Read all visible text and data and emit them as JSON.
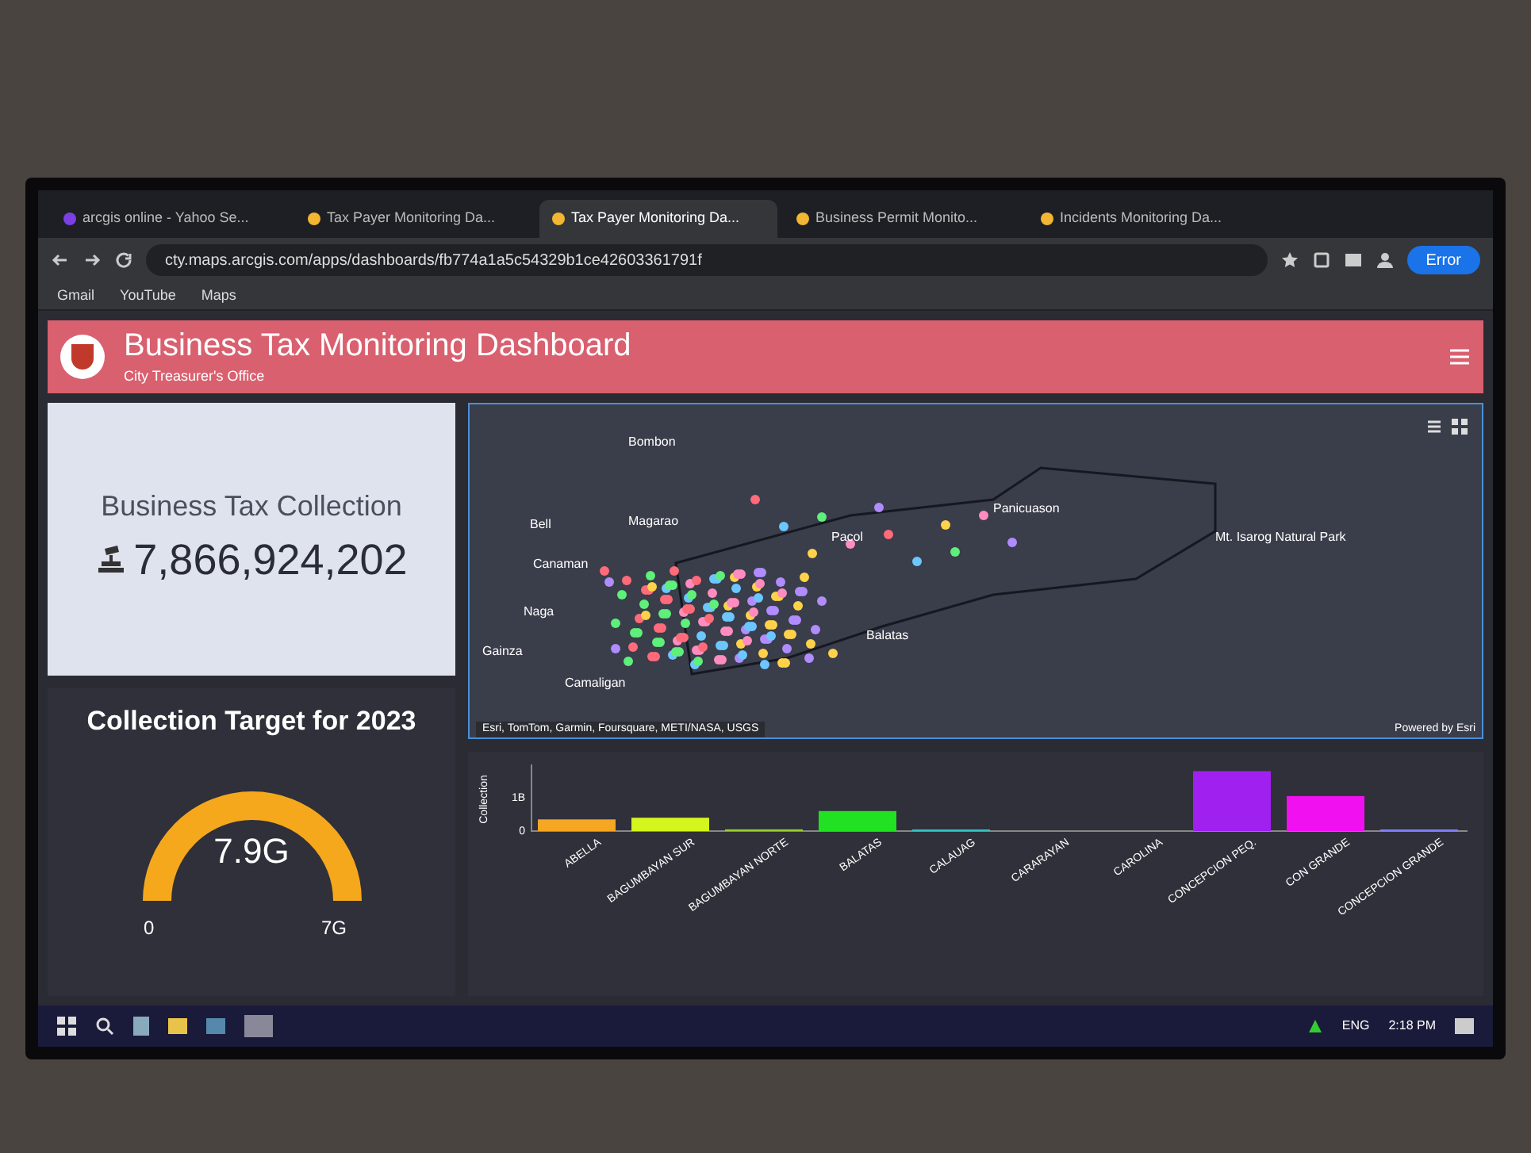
{
  "browser": {
    "tabs": [
      {
        "label": "arcgis online - Yahoo Se...",
        "selected": false
      },
      {
        "label": "Tax Payer Monitoring Da...",
        "selected": false
      },
      {
        "label": "Tax Payer Monitoring Da...",
        "selected": true
      },
      {
        "label": "Business Permit Monito...",
        "selected": false
      },
      {
        "label": "Incidents Monitoring Da...",
        "selected": false
      }
    ],
    "url": "cty.maps.arcgis.com/apps/dashboards/fb774a1a5c54329b1ce42603361791f",
    "bookmarks": [
      "Gmail",
      "YouTube",
      "Maps"
    ],
    "profile_button": "Error"
  },
  "header": {
    "title": "Business Tax Monitoring Dashboard",
    "subtitle": "City Treasurer's Office"
  },
  "collection_card": {
    "title": "Business Tax Collection",
    "value": "7,866,924,202"
  },
  "gauge": {
    "title": "Collection Target for 2023",
    "value": "7.9G",
    "min": "0",
    "max": "7G"
  },
  "map": {
    "labels": [
      "Bombon",
      "Bell",
      "Magarao",
      "Canaman",
      "Naga",
      "Pacol",
      "Panicuason",
      "Mt. Isarog Natural Park",
      "Gainza",
      "Camaligan",
      "Balatas"
    ],
    "attribution": "Esri, TomTom, Garmin, Foursquare, METI/NASA, USGS",
    "powered_by": "Powered by Esri"
  },
  "chart": {
    "chart_data": {
      "type": "bar",
      "ylabel": "Collection",
      "categories": [
        "ABELLA",
        "BAGUMBAYAN SUR",
        "BAGUMBAYAN NORTE",
        "BALATAS",
        "CALAUAG",
        "CARARAYAN",
        "CAROLINA",
        "CONCEPCION PEQ.",
        "CON GRANDE",
        "CONCEPCION GRANDE"
      ],
      "series": [
        {
          "values": [
            0.35,
            0.4,
            0.05,
            0.6,
            0.02,
            null,
            null,
            1.8,
            1.05,
            0
          ]
        }
      ],
      "colors": [
        "#f5a623",
        "#d4f51e",
        "#9acd32",
        "#22e022",
        "#35c0c0",
        null,
        null,
        "#a020f0",
        "#f010f0",
        "#8080ff"
      ],
      "ylim": [
        0,
        2
      ],
      "yticks": [
        0,
        {
          "value": 1,
          "label": "1B"
        }
      ]
    }
  },
  "taskbar": {
    "language": "ENG",
    "time": "2:18 PM"
  }
}
